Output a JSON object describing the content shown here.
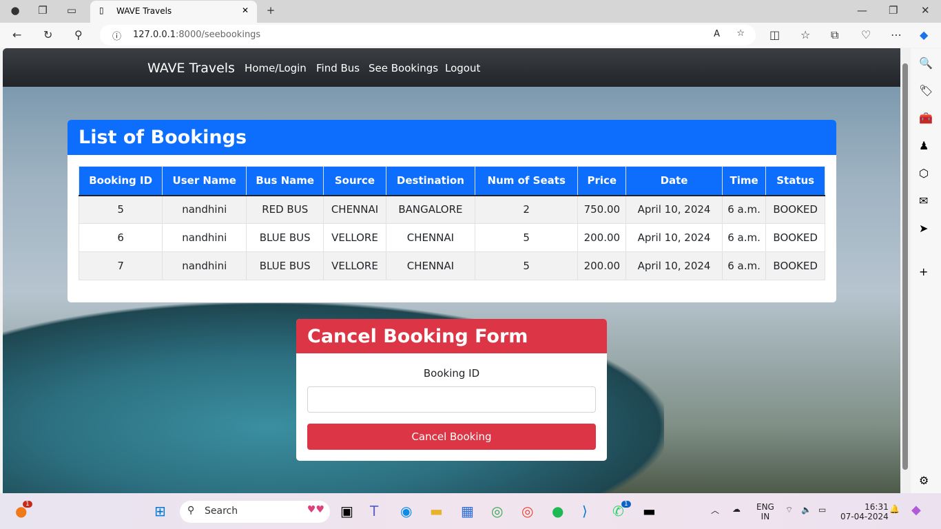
{
  "browser": {
    "tab_title": "WAVE Travels",
    "url_host": "127.0.0.1",
    "url_rest": ":8000/seebookings"
  },
  "nav": {
    "brand": "WAVE Travels",
    "links": [
      "Home/Login",
      "Find Bus",
      "See Bookings",
      "Logout"
    ]
  },
  "bookings": {
    "title": "List of Bookings",
    "columns": [
      "Booking ID",
      "User Name",
      "Bus Name",
      "Source",
      "Destination",
      "Num of Seats",
      "Price",
      "Date",
      "Time",
      "Status"
    ],
    "rows": [
      [
        "5",
        "nandhini",
        "RED BUS",
        "CHENNAI",
        "BANGALORE",
        "2",
        "750.00",
        "April 10, 2024",
        "6 a.m.",
        "BOOKED"
      ],
      [
        "6",
        "nandhini",
        "BLUE BUS",
        "VELLORE",
        "CHENNAI",
        "5",
        "200.00",
        "April 10, 2024",
        "6 a.m.",
        "BOOKED"
      ],
      [
        "7",
        "nandhini",
        "BLUE BUS",
        "VELLORE",
        "CHENNAI",
        "5",
        "200.00",
        "April 10, 2024",
        "6 a.m.",
        "BOOKED"
      ]
    ]
  },
  "cancel": {
    "title": "Cancel Booking Form",
    "label": "Booking ID",
    "value": "",
    "button": "Cancel Booking"
  },
  "taskbar": {
    "search": "Search",
    "lang1": "ENG",
    "lang2": "IN",
    "time": "16:31",
    "date": "07-04-2024",
    "badge_notif": "1",
    "whatsapp_badge": "1"
  },
  "colors": {
    "primary": "#0d6efd",
    "danger": "#dc3545",
    "navbar": "#212529"
  }
}
